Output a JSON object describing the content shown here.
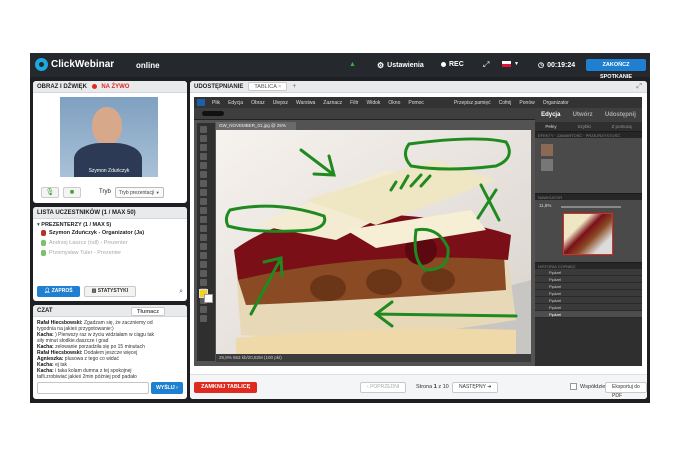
{
  "topbar": {
    "brand": "ClickWebinar",
    "status": "online",
    "settings": "Ustawienia",
    "rec": "REC",
    "timer": "00:19:24",
    "end_meeting": "ZAKOŃCZ SPOTKANIE"
  },
  "video_panel": {
    "title": "OBRAZ I DŹWIĘK",
    "live": "NA ŻYWO",
    "camera_name": "Szymon Zduńczyk",
    "mode_label": "Tryb",
    "mode_value": "Tryb prezentacji"
  },
  "participants": {
    "title": "LISTA UCZESTNIKÓW (1 / MAX 50)",
    "group": "PREZENTERZY (1 / MAX 5)",
    "items": [
      {
        "name": "Szymon Zduńczyk - Organizator (Ja)"
      },
      {
        "name": "Andrzej Łaszcz (ndl) - Prezenter"
      },
      {
        "name": "Przemysław Tuler - Prezenter"
      }
    ],
    "invite": "ZAPROŚ",
    "stats": "STATYSTYKI"
  },
  "chat": {
    "title": "CZAT",
    "tab": "Tłumacz",
    "messages": [
      {
        "author": "Rafał Hiecsbowski:",
        "text": "Zgadzam się, że zaczniemy od"
      },
      {
        "author": "",
        "text": "tygodnia na jakieś przygotowanie:)"
      },
      {
        "author": "Kacha:",
        "text": ") Pierwszy raz w życiu widziałam w ciągu tak"
      },
      {
        "author": "",
        "text": "siły minut słodkie.daszcze i grad"
      },
      {
        "author": "Kacha:",
        "text": "zelowanie porzadziła się po 15 minutach"
      },
      {
        "author": "Rafał Hiecsbowski:",
        "text": "Dodałem jeszcze więcej"
      },
      {
        "author": "Agnieszka:",
        "text": "plusowa z tego co widać"
      },
      {
        "author": "Kacha:",
        "text": "ej tak"
      },
      {
        "author": "Kacha:",
        "text": "i taka kolam dumna z tej spokojnej"
      },
      {
        "author": "",
        "text": "tafli.zrobiwiać jakieś 2min później pod padało"
      }
    ],
    "send": "WYŚLIJ"
  },
  "presentation": {
    "tab_share": "UDOSTĘPNIANIE",
    "tab_board": "TABLICA",
    "menu": [
      "Plik",
      "Edycja",
      "Obraz",
      "Ulepsz",
      "Warstwa",
      "Zaznacz",
      "Filtr",
      "Widok",
      "Okno",
      "Pomoc"
    ],
    "menu_right": [
      "Przepisz pamięć",
      "Cofnij",
      "Ponów",
      "Organizator"
    ],
    "doc_name": "GW_NOVEMBER_01.jpg @ 25% (RGB/8)",
    "status_line": "25,8%   563 kb/20,82M (100 pkt)",
    "panel_tabs": [
      "Edycja",
      "Utwórz",
      "Udostępnij"
    ],
    "panel_sub": [
      "Pełny",
      "Szybki",
      "Z pomocą"
    ],
    "strips": [
      "EFEKTY",
      "ZAWARTOŚĆ",
      "PRZEJRZYSTOŚĆ",
      "NAWIGATOR",
      "HISTORIA COFNIĘĆ"
    ],
    "zoom": "11,8%",
    "layers": [
      "Pędzel",
      "Pędzel",
      "Pędzel",
      "Pędzel",
      "Pędzel",
      "Pędzel",
      "Pędzel"
    ]
  },
  "pager": {
    "close_board": "ZAMKNIJ TABLICĘ",
    "previous": "POPRZEDNI",
    "page_label": "Strona",
    "page_current": "1",
    "page_of": "z",
    "page_total": "10",
    "next": "NASTĘPNY",
    "share_label": "Współdziel",
    "export": "Eksportuj do PDF"
  }
}
